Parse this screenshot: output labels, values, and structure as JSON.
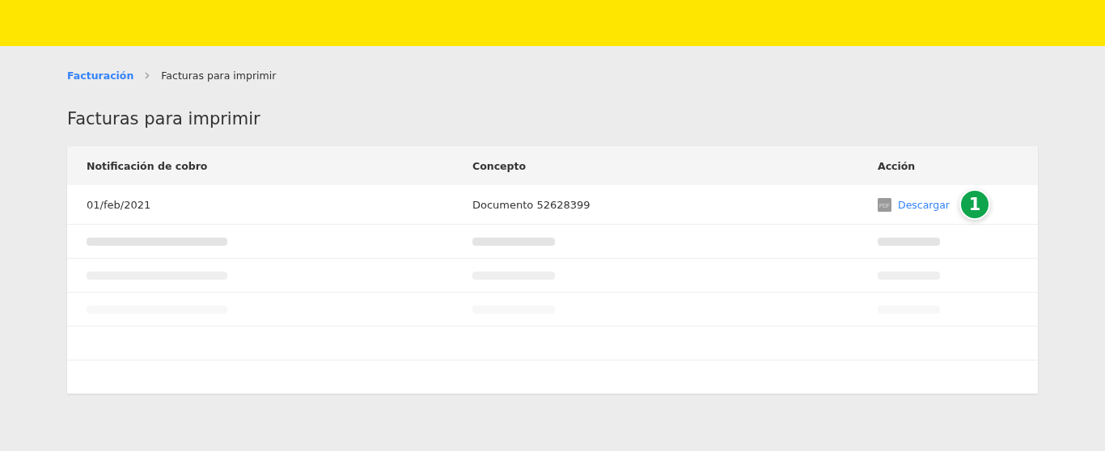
{
  "breadcrumb": {
    "link": "Facturación",
    "current": "Facturas para imprimir"
  },
  "title": "Facturas para imprimir",
  "table": {
    "columns": [
      "Notificación de cobro",
      "Concepto",
      "Acción"
    ],
    "rows": [
      {
        "kind": "data",
        "date": "01/feb/2021",
        "concept": "Documento 52628399",
        "action": "Descargar",
        "file_icon": "PDF",
        "step_badge": "1"
      },
      {
        "kind": "skeleton",
        "color": "#e4e4e4"
      },
      {
        "kind": "skeleton",
        "color": "#efefef"
      },
      {
        "kind": "skeleton",
        "color": "#f7f7f7"
      },
      {
        "kind": "empty"
      },
      {
        "kind": "empty"
      }
    ]
  }
}
